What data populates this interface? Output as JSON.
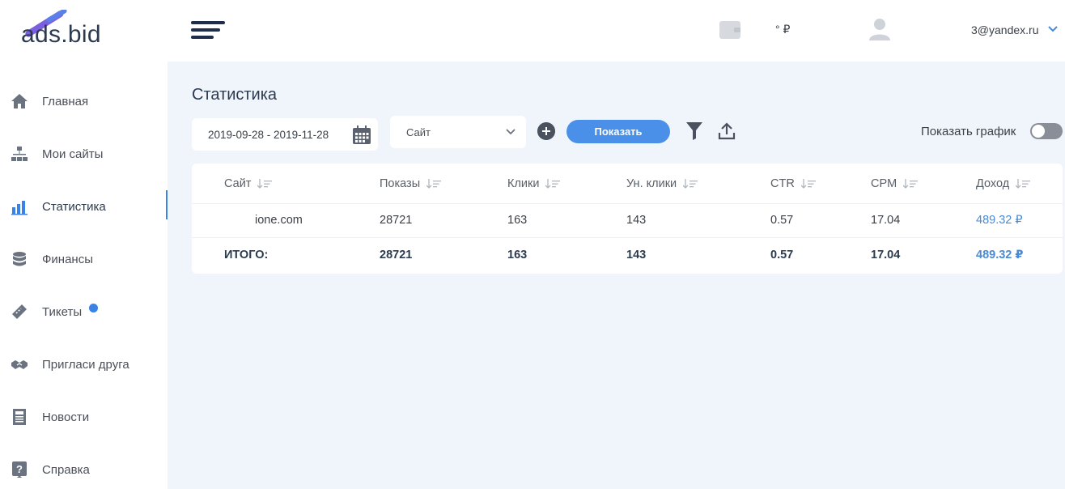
{
  "header": {
    "logo_text": "ads.bid",
    "balance": "° ₽",
    "user_email": "3@yandex.ru"
  },
  "sidebar": {
    "items": [
      {
        "label": "Главная",
        "icon": "home-icon"
      },
      {
        "label": "Мои сайты",
        "icon": "sitemap-icon"
      },
      {
        "label": "Статистика",
        "icon": "bar-chart-icon",
        "active": true
      },
      {
        "label": "Финансы",
        "icon": "coins-icon"
      },
      {
        "label": "Тикеты",
        "icon": "ticket-icon",
        "badge": true
      },
      {
        "label": "Пригласи друга",
        "icon": "handshake-icon"
      },
      {
        "label": "Новости",
        "icon": "newspaper-icon"
      },
      {
        "label": "Справка",
        "icon": "help-icon"
      }
    ]
  },
  "main": {
    "title": "Статистика",
    "date_range": "2019-09-28 - 2019-11-28",
    "site_select": "Сайт",
    "show_button": "Показать",
    "graph_toggle_label": "Показать график",
    "graph_toggle_on": false
  },
  "table": {
    "columns": [
      "Сайт",
      "Показы",
      "Клики",
      "Ун. клики",
      "CTR",
      "CPM",
      "Доход"
    ],
    "rows": [
      [
        "ione.com",
        "28721",
        "163",
        "143",
        "0.57",
        "17.04",
        "489.32 ₽"
      ]
    ],
    "total": [
      "ИТОГО:",
      "28721",
      "163",
      "143",
      "0.57",
      "17.04",
      "489.32 ₽"
    ]
  },
  "colors": {
    "accent": "#4a90e8",
    "money": "#4a8ad4",
    "background": "#f0f4fb",
    "logo_purple": "#7b5fe0"
  }
}
